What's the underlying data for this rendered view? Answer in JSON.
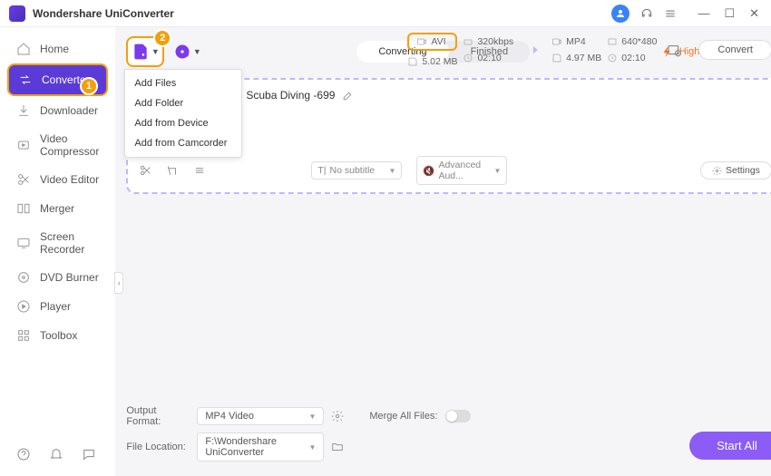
{
  "app": {
    "title": "Wondershare UniConverter"
  },
  "sidebar": {
    "items": [
      {
        "label": "Home"
      },
      {
        "label": "Converter"
      },
      {
        "label": "Downloader"
      },
      {
        "label": "Video Compressor"
      },
      {
        "label": "Video Editor"
      },
      {
        "label": "Merger"
      },
      {
        "label": "Screen Recorder"
      },
      {
        "label": "DVD Burner"
      },
      {
        "label": "Player"
      },
      {
        "label": "Toolbox"
      }
    ]
  },
  "badges": {
    "step1": "1",
    "step2": "2"
  },
  "add_menu": {
    "items": [
      {
        "label": "Add Files"
      },
      {
        "label": "Add Folder"
      },
      {
        "label": "Add from Device"
      },
      {
        "label": "Add from Camcorder"
      }
    ]
  },
  "tabs": {
    "converting": "Converting",
    "finished": "Finished"
  },
  "hsc": "High Speed Conversion",
  "file": {
    "title": "Scuba Diving -699",
    "src": {
      "format": "AVI",
      "bitrate": "320kbps",
      "size": "5.02 MB",
      "duration": "02:10"
    },
    "dst": {
      "format": "MP4",
      "resolution": "640*480",
      "size": "4.97 MB",
      "duration": "02:10"
    },
    "subtitle": "No subtitle",
    "audio": "Advanced Aud...",
    "settings": "Settings",
    "convert": "Convert"
  },
  "bottom": {
    "format_label": "Output Format:",
    "format_value": "MP4 Video",
    "merge_label": "Merge All Files:",
    "location_label": "File Location:",
    "location_value": "F:\\Wondershare UniConverter",
    "start": "Start All"
  }
}
